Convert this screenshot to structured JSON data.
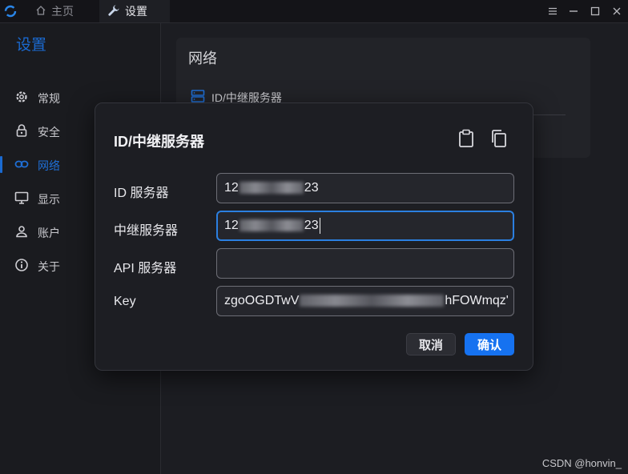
{
  "titlebar": {
    "tabs": [
      {
        "label": "主页",
        "icon": "home-icon"
      },
      {
        "label": "设置",
        "icon": "wrench-icon"
      }
    ],
    "controls": [
      "menu-icon",
      "minimize-icon",
      "maximize-icon",
      "close-icon"
    ]
  },
  "sidebar": {
    "title": "设置",
    "items": [
      {
        "label": "常规",
        "icon": "gear-icon"
      },
      {
        "label": "安全",
        "icon": "lock-icon"
      },
      {
        "label": "网络",
        "icon": "link-icon",
        "active": true
      },
      {
        "label": "显示",
        "icon": "monitor-icon"
      },
      {
        "label": "账户",
        "icon": "user-icon"
      },
      {
        "label": "关于",
        "icon": "info-icon"
      }
    ]
  },
  "main": {
    "title": "网络",
    "row_label": "ID/中继服务器"
  },
  "dialog": {
    "title": "ID/中继服务器",
    "fields": [
      {
        "label": "ID 服务器",
        "value_start": "12",
        "value_end": "23",
        "focused": false
      },
      {
        "label": "中继服务器",
        "value_start": "12",
        "value_end": "23",
        "focused": true
      },
      {
        "label": "API 服务器",
        "value_start": "",
        "value_end": "",
        "focused": false
      },
      {
        "label": "Key",
        "value_start": "zgoOGDTwV",
        "value_end": "hFOWmqz'",
        "focused": false
      }
    ],
    "cancel_label": "取消",
    "confirm_label": "确认"
  },
  "watermark": "CSDN @honvin_",
  "colors": {
    "accent": "#1672f0",
    "sidebar_active": "#1a6ad1",
    "background": "#1c1d22",
    "dialog_bg": "#1d1e23"
  }
}
